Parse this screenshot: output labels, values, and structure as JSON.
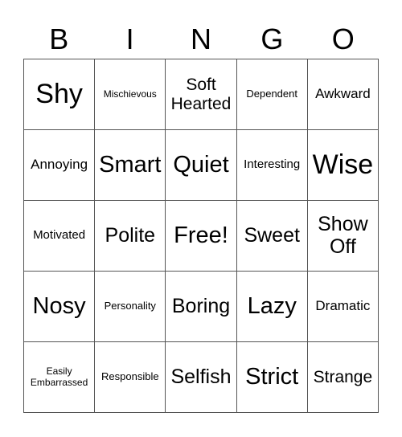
{
  "header": {
    "letters": [
      "B",
      "I",
      "N",
      "G",
      "O"
    ]
  },
  "board": {
    "cells": [
      [
        "Shy",
        "Mischievous",
        "Soft Hearted",
        "Dependent",
        "Awkward"
      ],
      [
        "Annoying",
        "Smart",
        "Quiet",
        "Interesting",
        "Wise"
      ],
      [
        "Motivated",
        "Polite",
        "Free!",
        "Sweet",
        "Show Off"
      ],
      [
        "Nosy",
        "Personality",
        "Boring",
        "Lazy",
        "Dramatic"
      ],
      [
        "Easily Embarrassed",
        "Responsible",
        "Selfish",
        "Strict",
        "Strange"
      ]
    ]
  }
}
